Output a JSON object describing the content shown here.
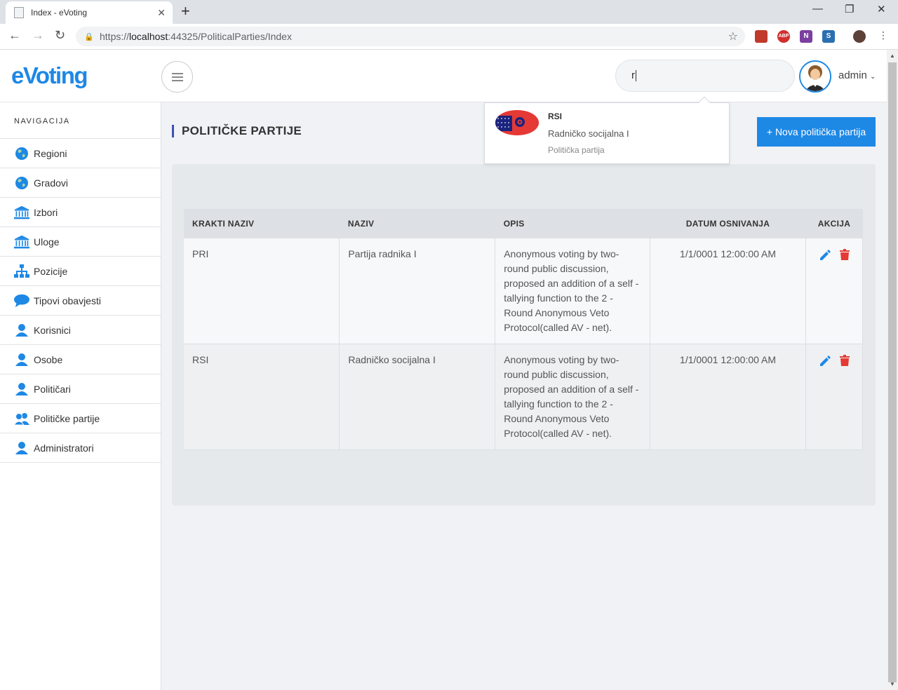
{
  "browser": {
    "tab_title": "Index - eVoting",
    "url_prefix": "https://",
    "url_host": "localhost",
    "url_rest": ":44325/PoliticalParties/Index",
    "extensions": [
      "ABP",
      "N",
      "S"
    ]
  },
  "header": {
    "brand": "eVoting",
    "search_value": "r",
    "user_name": "admin"
  },
  "sidebar": {
    "heading": "NAVIGACIJA",
    "items": [
      {
        "label": "Regioni",
        "icon": "globe-icon"
      },
      {
        "label": "Gradovi",
        "icon": "globe-icon"
      },
      {
        "label": "Izbori",
        "icon": "institution-icon"
      },
      {
        "label": "Uloge",
        "icon": "institution-icon"
      },
      {
        "label": "Pozicije",
        "icon": "sitemap-icon"
      },
      {
        "label": "Tipovi obavjesti",
        "icon": "speech-bubble-icon"
      },
      {
        "label": "Korisnici",
        "icon": "user-icon"
      },
      {
        "label": "Osobe",
        "icon": "user-icon"
      },
      {
        "label": "Političari",
        "icon": "user-icon"
      },
      {
        "label": "Političke partije",
        "icon": "users-icon"
      },
      {
        "label": "Administratori",
        "icon": "user-icon"
      }
    ]
  },
  "main": {
    "title": "POLITIČKE PARTIJE",
    "new_button": "+ Nova politička partija",
    "table": {
      "headers": [
        "KRAKTI NAZIV",
        "NAZIV",
        "OPIS",
        "DATUM OSNIVANJA",
        "AKCIJA"
      ],
      "rows": [
        {
          "short": "PRI",
          "name": "Partija radnika I",
          "desc": "Anonymous voting by two-round public discussion, proposed an addition of a self - tallying function to the 2 - Round Anonymous Veto Protocol(called AV - net).",
          "date": "1/1/0001 12:00:00 AM"
        },
        {
          "short": "RSI",
          "name": "Radničko socijalna I",
          "desc": "Anonymous voting by two-round public discussion, proposed an addition of a self - tallying function to the 2 - Round Anonymous Veto Protocol(called AV - net).",
          "date": "1/1/0001 12:00:00 AM"
        }
      ]
    }
  },
  "search_dropdown": {
    "code": "RSI",
    "name": "Radničko socijalna I",
    "type": "Politička partija"
  },
  "colors": {
    "accent": "#1e88e5",
    "title_bar": "#3f51b5",
    "delete": "#e53935"
  }
}
